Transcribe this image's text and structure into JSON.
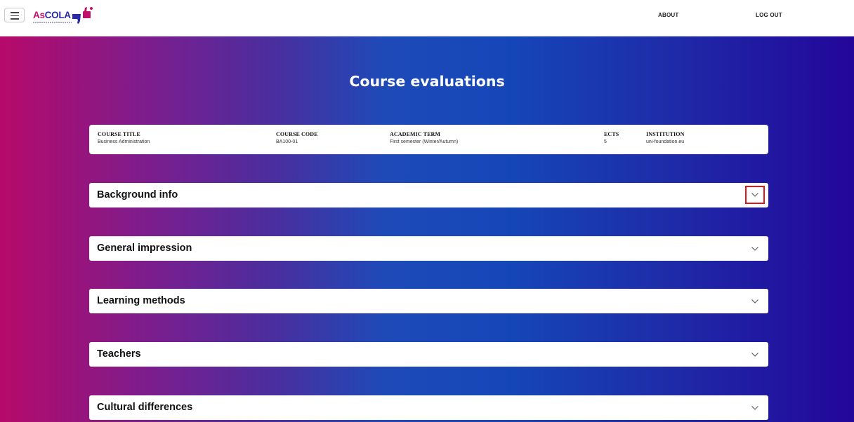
{
  "navbar": {
    "logo": {
      "part1": "As",
      "part2": "COLA"
    },
    "links": [
      {
        "label": "ABOUT"
      },
      {
        "label": "LOG OUT"
      }
    ]
  },
  "hero": {
    "title": "Course evaluations"
  },
  "course_info": {
    "columns": [
      {
        "header": "COURSE TITLE",
        "value": "Business Administration"
      },
      {
        "header": "COURSE CODE",
        "value": "BA100-01"
      },
      {
        "header": "ACADEMIC TERM",
        "value": "First semester (Winter/Autumn)"
      },
      {
        "header": "ECTS",
        "value": "5"
      },
      {
        "header": "INSTITUTION",
        "value": "uni-foundation.eu"
      }
    ]
  },
  "sections": [
    {
      "title": "Background info",
      "icon": "chevron-down-icon",
      "highlighted": true
    },
    {
      "title": "General impression",
      "icon": "chevron-down-icon"
    },
    {
      "title": "Learning methods",
      "icon": "chevron-down-icon"
    },
    {
      "title": "Teachers",
      "icon": "chevron-down-icon"
    },
    {
      "title": "Cultural differences",
      "icon": "chevron-down-icon"
    }
  ],
  "colors": {
    "gradient_left": "#b60a6a",
    "gradient_mid": "#1546b8",
    "gradient_right": "#23069a",
    "highlight_border": "#e0161a"
  }
}
